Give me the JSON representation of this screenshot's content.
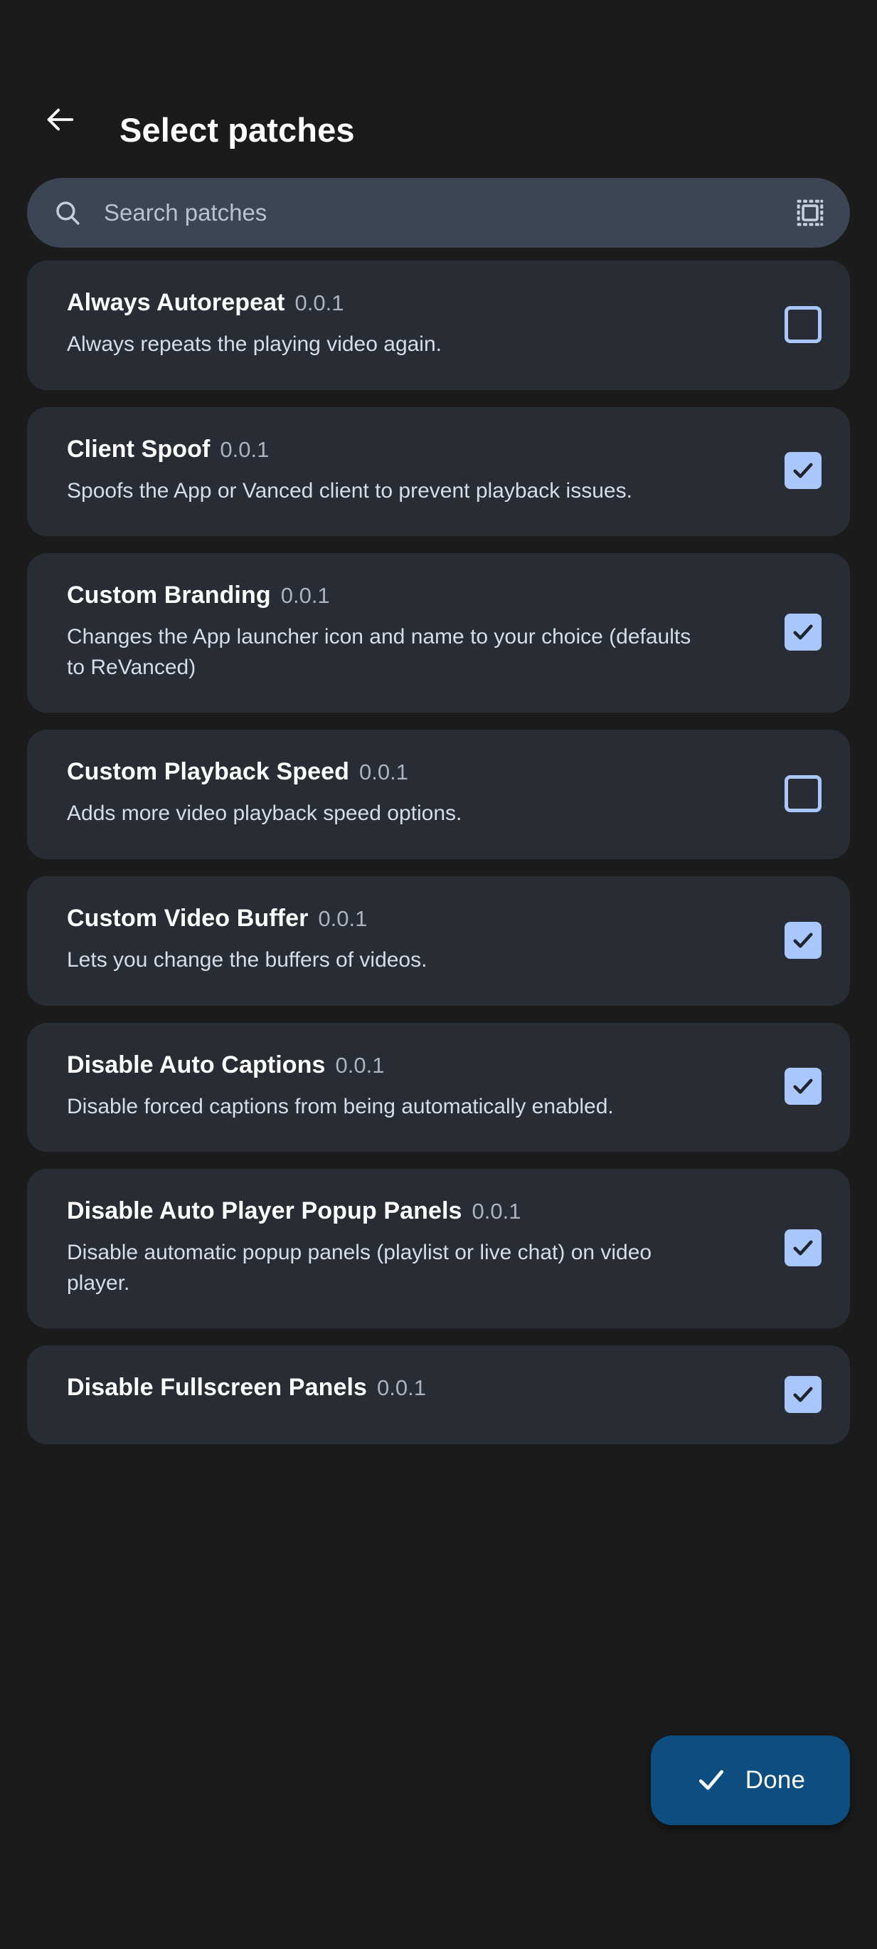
{
  "appbar": {
    "back_icon": "arrow-left-icon",
    "title": "Select patches"
  },
  "search": {
    "placeholder": "Search patches",
    "value": "",
    "leading_icon": "search-icon",
    "trailing_icon": "select-all-icon"
  },
  "colors": {
    "page_background": "#1b1b1c",
    "card_background": "#282c35",
    "search_background": "#3b4553",
    "checkbox_accent": "#a9c7fa",
    "fab_background": "#0e4d80",
    "title_text": "#ffffff",
    "description_text": "#d4dde8",
    "version_text": "#a9b3c2"
  },
  "patches": [
    {
      "name": "Always Autorepeat",
      "version": "0.0.1",
      "description": "Always repeats the playing video again.",
      "checked": false
    },
    {
      "name": "Client Spoof",
      "version": "0.0.1",
      "description": "Spoofs the App or Vanced client to prevent playback issues.",
      "checked": true
    },
    {
      "name": "Custom Branding",
      "version": "0.0.1",
      "description": "Changes the App launcher icon and name to your choice (defaults to ReVanced)",
      "checked": true
    },
    {
      "name": "Custom Playback Speed",
      "version": "0.0.1",
      "description": "Adds more video playback speed options.",
      "checked": false
    },
    {
      "name": "Custom Video Buffer",
      "version": "0.0.1",
      "description": "Lets you change the buffers of videos.",
      "checked": true
    },
    {
      "name": "Disable Auto Captions",
      "version": "0.0.1",
      "description": "Disable forced captions from being automatically enabled.",
      "checked": true
    },
    {
      "name": "Disable Auto Player Popup Panels",
      "version": "0.0.1",
      "description": "Disable automatic popup panels (playlist or live chat) on video player.",
      "checked": true
    },
    {
      "name": "Disable Fullscreen Panels",
      "version": "0.0.1",
      "description": "",
      "checked": true
    }
  ],
  "fab": {
    "label": "Done",
    "icon": "check-icon"
  }
}
